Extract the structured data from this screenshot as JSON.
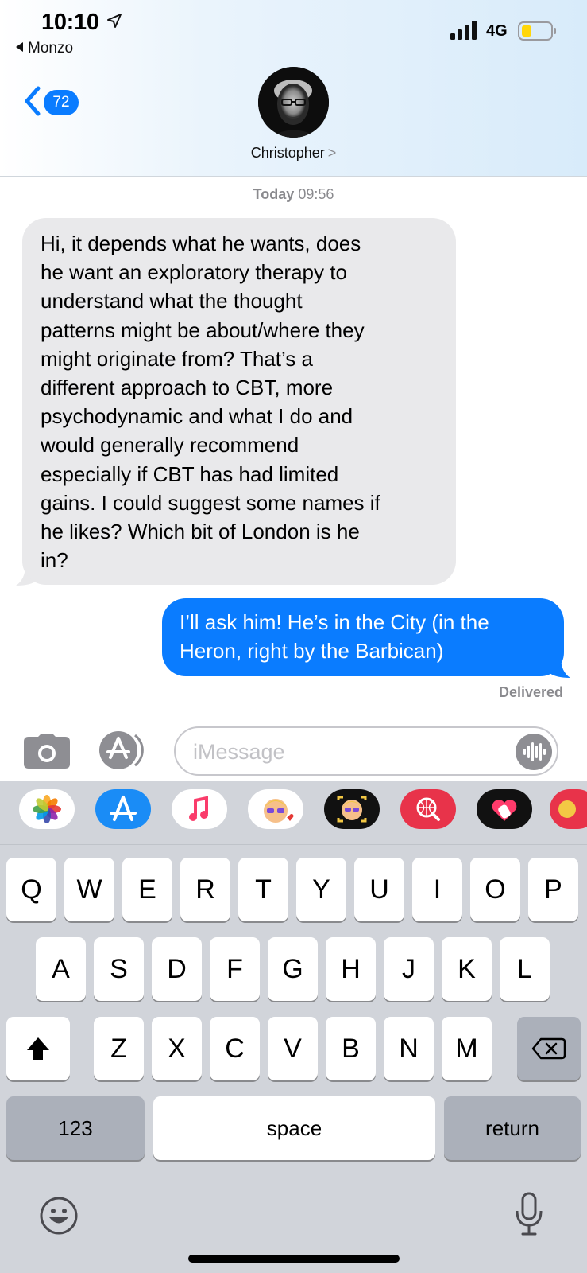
{
  "status_bar": {
    "time": "10:10",
    "back_app": "Monzo",
    "network": "4G"
  },
  "header": {
    "back_badge": "72",
    "contact_name": "Christopher",
    "name_chevron": ">"
  },
  "conversation": {
    "timestamp_day": "Today",
    "timestamp_time": "09:56",
    "messages": [
      {
        "direction": "incoming",
        "lines": [
          "Hi, it depends what he wants, does",
          "he want an exploratory therapy to",
          "understand what the thought",
          "patterns might be about/where they",
          "might originate from? That’s a",
          "different approach to CBT, more",
          "psychodynamic and what I do and",
          "would generally recommend",
          "especially if CBT has had limited",
          "gains. I could suggest some names if",
          "he likes?  Which bit of London is he",
          "in?"
        ]
      },
      {
        "direction": "outgoing",
        "lines": [
          "I’ll ask him! He’s in the City (in the",
          "Heron, right by the Barbican)"
        ]
      }
    ],
    "delivery_status": "Delivered"
  },
  "input_bar": {
    "placeholder": "iMessage",
    "value": ""
  },
  "app_strip": [
    {
      "name": "photos-app-icon"
    },
    {
      "name": "appstore-app-icon"
    },
    {
      "name": "music-app-icon"
    },
    {
      "name": "memoji-stickers-icon"
    },
    {
      "name": "animoji-icon"
    },
    {
      "name": "image-search-icon"
    },
    {
      "name": "digital-touch-icon"
    },
    {
      "name": "partial-app-icon"
    }
  ],
  "keyboard": {
    "row1": [
      "Q",
      "W",
      "E",
      "R",
      "T",
      "Y",
      "U",
      "I",
      "O",
      "P"
    ],
    "row2": [
      "A",
      "S",
      "D",
      "F",
      "G",
      "H",
      "J",
      "K",
      "L"
    ],
    "row3": [
      "Z",
      "X",
      "C",
      "V",
      "B",
      "N",
      "M"
    ],
    "numbers_label": "123",
    "space_label": "space",
    "return_label": "return"
  },
  "colors": {
    "imessage_blue": "#0a7cff",
    "incoming_bubble": "#e9e9eb",
    "keyboard_bg": "#d1d4da",
    "battery_fill": "#ffd60a"
  }
}
